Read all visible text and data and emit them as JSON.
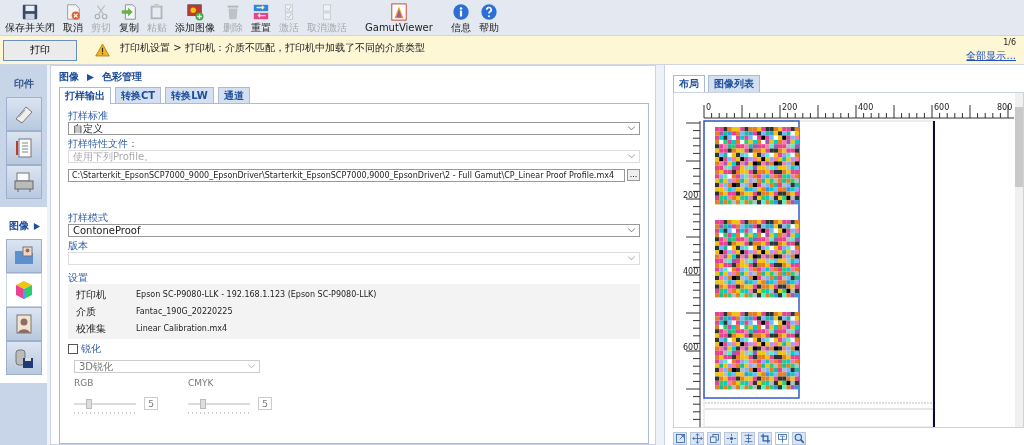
{
  "toolbar": [
    {
      "label": "保存并关闭",
      "disabled": false
    },
    {
      "label": "取消",
      "disabled": false
    },
    {
      "label": "剪切",
      "disabled": true
    },
    {
      "label": "复制",
      "disabled": false
    },
    {
      "label": "粘贴",
      "disabled": true
    },
    {
      "label": "添加图像",
      "disabled": false
    },
    {
      "label": "删除",
      "disabled": true
    },
    {
      "label": "重置",
      "disabled": false
    },
    {
      "label": "激活",
      "disabled": true
    },
    {
      "label": "取消激活",
      "disabled": true
    },
    {
      "label": "GamutViewer",
      "disabled": false
    },
    {
      "label": "信息",
      "disabled": false
    },
    {
      "label": "帮助",
      "disabled": false
    }
  ],
  "print_button": "打印",
  "message": "打印机设置 > 打印机：介质不匹配，打印机中加载了不同的介质类型",
  "pager": {
    "page": "1/6",
    "show_all": "全部显示..."
  },
  "sidebar": [
    {
      "title": "印件",
      "expanded": false,
      "items": [
        {
          "selected": false
        },
        {
          "selected": false
        },
        {
          "selected": false
        }
      ]
    },
    {
      "title": "图像",
      "expanded": true,
      "items": [
        {
          "selected": false
        },
        {
          "selected": true
        },
        {
          "selected": false
        },
        {
          "selected": false
        }
      ]
    }
  ],
  "breadcrumb": [
    "图像",
    "色彩管理"
  ],
  "tabs": [
    {
      "label": "打样输出",
      "selected": true
    },
    {
      "label": "转换CT",
      "selected": false
    },
    {
      "label": "转换LW",
      "selected": false
    },
    {
      "label": "通道",
      "selected": false
    }
  ],
  "form": {
    "proof_standard": {
      "label": "打样标准",
      "value": "自定义"
    },
    "profile": {
      "label": "打样特性文件：",
      "value": "使用下列Profile。",
      "disabled": true
    },
    "profile_path": {
      "value": "C:\\Starterkit_EpsonSCP7000_9000_EpsonDriver\\Starterkit_EpsonSCP7000,9000_EpsonDriver\\2 - Full Gamut\\CP_Linear Proof Profile.mx4",
      "browse": "..."
    },
    "proof_mode": {
      "label": "打样模式",
      "value": "ContoneProof"
    },
    "version": {
      "label": "版本",
      "disabled": true
    },
    "settings": {
      "title": "设置",
      "rows": [
        {
          "name": "打印机",
          "value": "Epson SC-P9080-LLK - 192.168.1.123 (Epson SC-P9080-LLK)"
        },
        {
          "name": "介质",
          "value": "Fantac_190G_20220225"
        },
        {
          "name": "校准集",
          "value": "Linear Calibration.mx4"
        }
      ]
    },
    "sharpen": {
      "label": "锐化",
      "checked": false,
      "mode": "3D锐化",
      "sliders": [
        {
          "label": "RGB",
          "level": 0.25,
          "value": "5"
        },
        {
          "label": "CMYK",
          "level": 0.25,
          "value": "5"
        }
      ]
    }
  },
  "view_tabs": [
    {
      "label": "布局",
      "selected": true
    },
    {
      "label": "图像列表",
      "selected": false
    }
  ],
  "ruler": {
    "x_labels": [
      "0",
      "200",
      "400",
      "600",
      "800"
    ],
    "y_labels": [
      "200",
      "400",
      "600"
    ]
  },
  "bottom_tools": [
    {
      "selected": false
    },
    {
      "selected": false
    },
    {
      "selected": false
    },
    {
      "selected": false
    },
    {
      "selected": false
    },
    {
      "selected": false
    },
    {
      "selected": true
    },
    {
      "selected": false
    }
  ]
}
